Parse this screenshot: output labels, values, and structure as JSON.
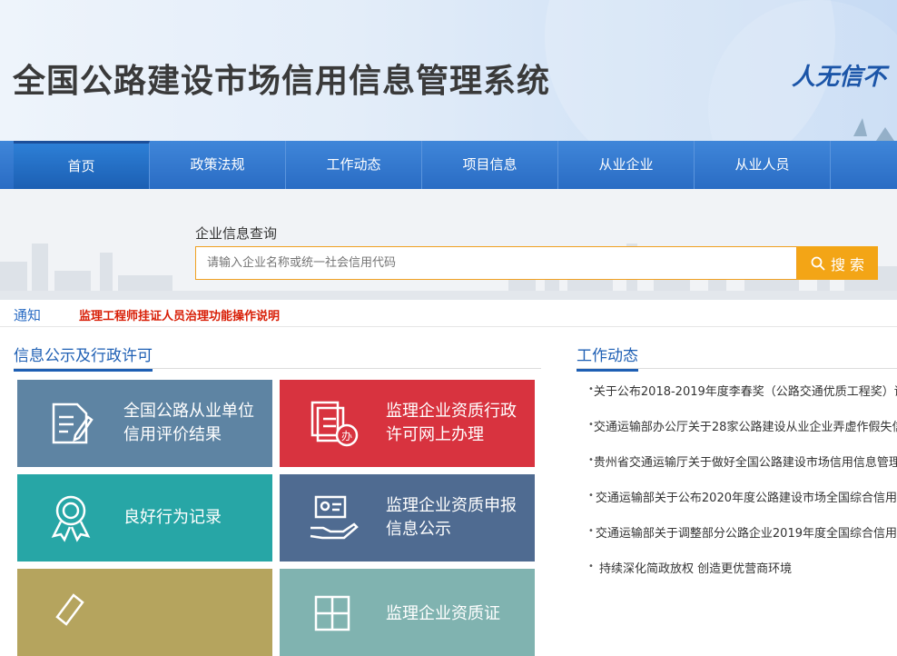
{
  "header": {
    "title": "全国公路建设市场信用信息管理系统",
    "slogan": "人无信不"
  },
  "nav": {
    "items": [
      {
        "label": "首页"
      },
      {
        "label": "政策法规"
      },
      {
        "label": "工作动态"
      },
      {
        "label": "项目信息"
      },
      {
        "label": "从业企业"
      },
      {
        "label": "从业人员"
      }
    ]
  },
  "search": {
    "label": "企业信息查询",
    "placeholder": "请输入企业名称或统一社会信用代码",
    "button_label": "搜 索"
  },
  "notice": {
    "label": "通知",
    "text": "监理工程师挂证人员治理功能操作说明"
  },
  "left_section": {
    "title": "信息公示及行政许可",
    "tiles": [
      {
        "label": "全国公路从业单位信用评价结果",
        "color": "#5e84a3",
        "icon": "document-edit-icon"
      },
      {
        "label": "监理企业资质行政许可网上办理",
        "color": "#d8333f",
        "icon": "office-document-icon"
      },
      {
        "label": "良好行为记录",
        "color": "#27a6a6",
        "icon": "award-medal-icon"
      },
      {
        "label": "监理企业资质申报信息公示",
        "color": "#4f6b91",
        "icon": "hand-certificate-icon"
      },
      {
        "label": "",
        "color": "#b5a45e",
        "icon": "pen-icon"
      },
      {
        "label": "监理企业资质证",
        "color": "#80b3b0",
        "icon": "grid-icon"
      }
    ]
  },
  "right_section": {
    "title": "工作动态",
    "news": [
      "关于公布2018-2019年度李春奖（公路交通优质工程奖）评",
      "交通运输部办公厅关于28家公路建设从业企业弄虚作假失信",
      "贵州省交通运输厅关于做好全国公路建设市场信用信息管理",
      "交通运输部关于公布2020年度公路建设市场全国综合信用",
      "交通运输部关于调整部分公路企业2019年度全国综合信用",
      "持续深化简政放权 创造更优营商环境"
    ]
  },
  "colors": {
    "nav_blue": "#2a6cc4",
    "search_orange": "#f3a516",
    "notice_red": "#d81e06"
  }
}
